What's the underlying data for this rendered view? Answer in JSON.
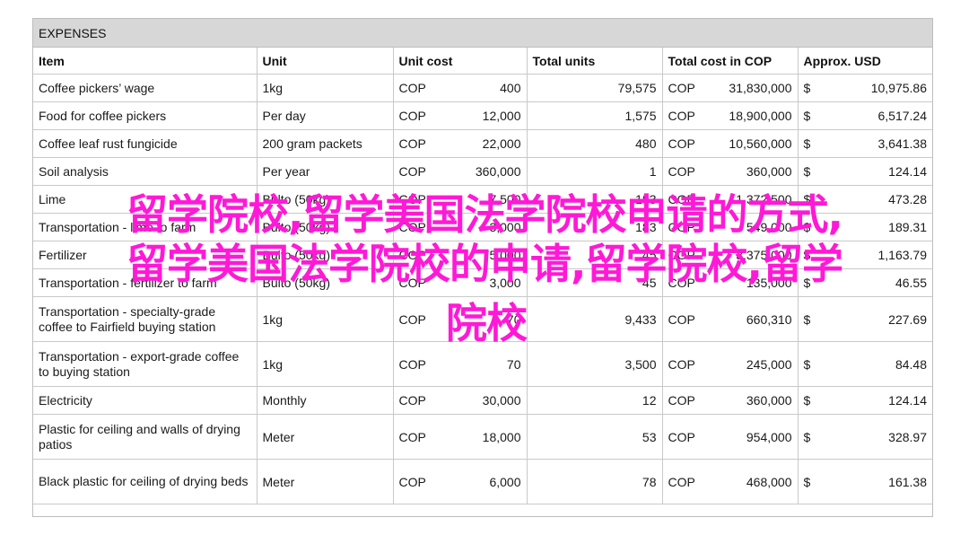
{
  "sheet": {
    "title": "EXPENSES",
    "columns": [
      "Item",
      "Unit",
      "Unit cost",
      "Total units",
      "Total cost in COP",
      "Approx. USD"
    ],
    "rows": [
      {
        "item": "Coffee pickers’ wage",
        "unit": "1kg",
        "uc_cur": "COP",
        "uc_val": "400",
        "total_units": "79,575",
        "tc_cur": "COP",
        "tc_val": "31,830,000",
        "usd_cur": "$",
        "usd_val": "10,975.86"
      },
      {
        "item": "Food for coffee pickers",
        "unit": "Per day",
        "uc_cur": "COP",
        "uc_val": "12,000",
        "total_units": "1,575",
        "tc_cur": "COP",
        "tc_val": "18,900,000",
        "usd_cur": "$",
        "usd_val": "6,517.24"
      },
      {
        "item": "Coffee leaf rust fungicide",
        "unit": "200 gram packets",
        "uc_cur": "COP",
        "uc_val": "22,000",
        "total_units": "480",
        "tc_cur": "COP",
        "tc_val": "10,560,000",
        "usd_cur": "$",
        "usd_val": "3,641.38"
      },
      {
        "item": "Soil analysis",
        "unit": "Per year",
        "uc_cur": "COP",
        "uc_val": "360,000",
        "total_units": "1",
        "tc_cur": "COP",
        "tc_val": "360,000",
        "usd_cur": "$",
        "usd_val": "124.14"
      },
      {
        "item": "Lime",
        "unit": "Bulto (50kg)",
        "uc_cur": "COP",
        "uc_val": "7,500",
        "total_units": "183",
        "tc_cur": "COP",
        "tc_val": "1,372,500",
        "usd_cur": "$",
        "usd_val": "473.28"
      },
      {
        "item": "Transportation - lime to farm",
        "unit": "Bulto (50kg)",
        "uc_cur": "COP",
        "uc_val": "3,000",
        "total_units": "183",
        "tc_cur": "COP",
        "tc_val": "549,000",
        "usd_cur": "$",
        "usd_val": "189.31"
      },
      {
        "item": "Fertilizer",
        "unit": "Bulto (50kg)",
        "uc_cur": "COP",
        "uc_val": "75,000",
        "total_units": "45",
        "tc_cur": "COP",
        "tc_val": "3,375,000",
        "usd_cur": "$",
        "usd_val": "1,163.79"
      },
      {
        "item": "Transportation - fertilizer to farm",
        "unit": "Bulto (50kg)",
        "uc_cur": "COP",
        "uc_val": "3,000",
        "total_units": "45",
        "tc_cur": "COP",
        "tc_val": "135,000",
        "usd_cur": "$",
        "usd_val": "46.55"
      },
      {
        "item": "Transportation - specialty-grade coffee to Fairfield buying station",
        "unit": "1kg",
        "uc_cur": "COP",
        "uc_val": "70",
        "total_units": "9,433",
        "tc_cur": "COP",
        "tc_val": "660,310",
        "usd_cur": "$",
        "usd_val": "227.69"
      },
      {
        "item": "Transportation - export-grade coffee to buying station",
        "unit": "1kg",
        "uc_cur": "COP",
        "uc_val": "70",
        "total_units": "3,500",
        "tc_cur": "COP",
        "tc_val": "245,000",
        "usd_cur": "$",
        "usd_val": "84.48"
      },
      {
        "item": "Electricity",
        "unit": "Monthly",
        "uc_cur": "COP",
        "uc_val": "30,000",
        "total_units": "12",
        "tc_cur": "COP",
        "tc_val": "360,000",
        "usd_cur": "$",
        "usd_val": "124.14"
      },
      {
        "item": "Plastic for ceiling and walls of drying patios",
        "unit": "Meter",
        "uc_cur": "COP",
        "uc_val": "18,000",
        "total_units": "53",
        "tc_cur": "COP",
        "tc_val": "954,000",
        "usd_cur": "$",
        "usd_val": "328.97"
      },
      {
        "item": "Black plastic for ceiling of drying beds",
        "unit": "Meter",
        "uc_cur": "COP",
        "uc_val": "6,000",
        "total_units": "78",
        "tc_cur": "COP",
        "tc_val": "468,000",
        "usd_cur": "$",
        "usd_val": "161.38"
      }
    ]
  },
  "overlay": {
    "lines": [
      "留学院校,留学美国法学院校申请的方式,",
      "留学美国法学院校的申请,留学院校,留学",
      "院校"
    ],
    "color": "#ff19d6"
  }
}
